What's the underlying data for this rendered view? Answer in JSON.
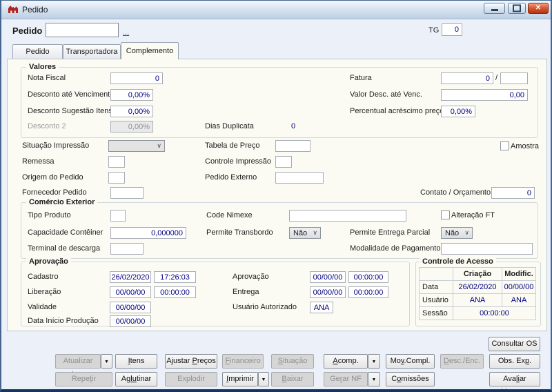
{
  "colors": {
    "value_navy": "#00007d",
    "titlebar_gradient_top": "#f3f8fd",
    "close_red": "#c0392b",
    "panel_bg": "#fbfbf4"
  },
  "window": {
    "title": "Pedido"
  },
  "header": {
    "pedido_label": "Pedido",
    "pedido_value": "",
    "lookup_label": "...",
    "tg_label": "TG",
    "tg_value": "0"
  },
  "tabs": [
    {
      "label": "Pedido"
    },
    {
      "label": "Transportadora"
    },
    {
      "label": "Complemento"
    }
  ],
  "valores": {
    "title": "Valores",
    "nota_fiscal": {
      "label": "Nota Fiscal",
      "value": "0"
    },
    "fatura": {
      "label": "Fatura",
      "value": "0",
      "separator": "/",
      "value2": ""
    },
    "desconto_venc": {
      "label": "Desconto até Vencimento",
      "value": "0,00%"
    },
    "valor_desc_venc": {
      "label": "Valor Desc. até Venc.",
      "value": "0,00"
    },
    "desconto_sugestao": {
      "label": "Desconto Sugestão Itens",
      "value": "0,00%"
    },
    "percentual_acrescimo": {
      "label": "Percentual acréscimo preço",
      "value": "0,00%"
    },
    "desconto2": {
      "label": "Desconto 2",
      "value": "0,00%"
    },
    "dias_duplicata": {
      "label": "Dias Duplicata",
      "value": "0"
    }
  },
  "meio": {
    "situacao_impressao": {
      "label": "Situação Impressão",
      "value": ""
    },
    "tabela_preco": {
      "label": "Tabela de Preço",
      "value": ""
    },
    "amostra": {
      "label": "Amostra",
      "checked": false
    },
    "remessa": {
      "label": "Remessa",
      "value": ""
    },
    "controle_impressao": {
      "label": "Controle Impressão",
      "value": ""
    },
    "origem_pedido": {
      "label": "Origem do Pedido",
      "value": ""
    },
    "pedido_externo": {
      "label": "Pedido Externo",
      "value": ""
    },
    "fornecedor_pedido": {
      "label": "Fornecedor Pedido",
      "value": ""
    },
    "contato_orcamento": {
      "label": "Contato / Orçamento",
      "value": "0"
    }
  },
  "comercio": {
    "title": "Comércio Exterior",
    "tipo_produto": {
      "label": "Tipo Produto",
      "value": ""
    },
    "code_nimexe": {
      "label": "Code Nimexe",
      "value": ""
    },
    "alteracao_ft": {
      "label": "Alteração FT",
      "checked": false
    },
    "capacidade_conteiner": {
      "label": "Capacidade Contêiner",
      "value": "0,000000"
    },
    "permite_transbordo": {
      "label": "Permite Transbordo",
      "value": "Não"
    },
    "permite_entrega_parcial": {
      "label": "Permite Entrega Parcial",
      "value": "Não"
    },
    "terminal_descarga": {
      "label": "Terminal de descarga",
      "value": ""
    },
    "modalidade_pagamento": {
      "label": "Modalidade de Pagamento",
      "value": ""
    }
  },
  "aprovacao": {
    "title": "Aprovação",
    "cadastro": {
      "label": "Cadastro",
      "date": "26/02/2020",
      "time": "17:26:03"
    },
    "liberacao": {
      "label": "Liberação",
      "date": "00/00/00",
      "time": "00:00:00"
    },
    "validade": {
      "label": "Validade",
      "date": "00/00/00"
    },
    "data_inicio_producao": {
      "label": "Data Início Produção",
      "date": "00/00/00"
    },
    "aprovacao_col": {
      "label": "Aprovação",
      "date": "00/00/00",
      "time": "00:00:00"
    },
    "entrega": {
      "label": "Entrega",
      "date": "00/00/00",
      "time": "00:00:00"
    },
    "usuario_autorizado": {
      "label": "Usuário Autorizado",
      "value": "ANA"
    }
  },
  "controle_acesso": {
    "title": "Controle de Acesso",
    "col_criacao": "Criação",
    "col_modific": "Modific.",
    "rows": [
      {
        "label": "Data",
        "criacao": "26/02/2020",
        "modific": "00/00/00"
      },
      {
        "label": "Usuário",
        "criacao": "ANA",
        "modific": "ANA"
      }
    ],
    "sessao": {
      "label": "Sessão",
      "value": "00:00:00"
    }
  },
  "toolbar": {
    "consultar_os": "Consultar OS",
    "row1": [
      {
        "html": "Atualizar Imp"
      },
      {
        "html": "<u>I</u>tens"
      },
      {
        "html": "Ajustar <u>P</u>reços"
      },
      {
        "html": "<u>F</u>inanceiro"
      },
      {
        "html": "<u>S</u>ituação"
      },
      {
        "html": "<u>A</u>comp."
      },
      {
        "html": "Mo<u>v</u>.Compl."
      },
      {
        "html": "<u>D</u>esc./Enc."
      },
      {
        "html": "Obs. Ex<u>p</u>."
      }
    ],
    "row2": [
      {
        "html": "Repe<u>t</u>ir"
      },
      {
        "html": "Ag<u>lu</u>tinar"
      },
      {
        "html": "Explodir"
      },
      {
        "html": "<u>I</u>mprimir"
      },
      {
        "html": "<u>B</u>aixar"
      },
      {
        "html": "Ge<u>r</u>ar NF"
      },
      {
        "html": "C<u>o</u>missões"
      },
      {
        "html": "Ava<u>li</u>ar Margem"
      }
    ],
    "dropdown_arrow": "▼"
  }
}
